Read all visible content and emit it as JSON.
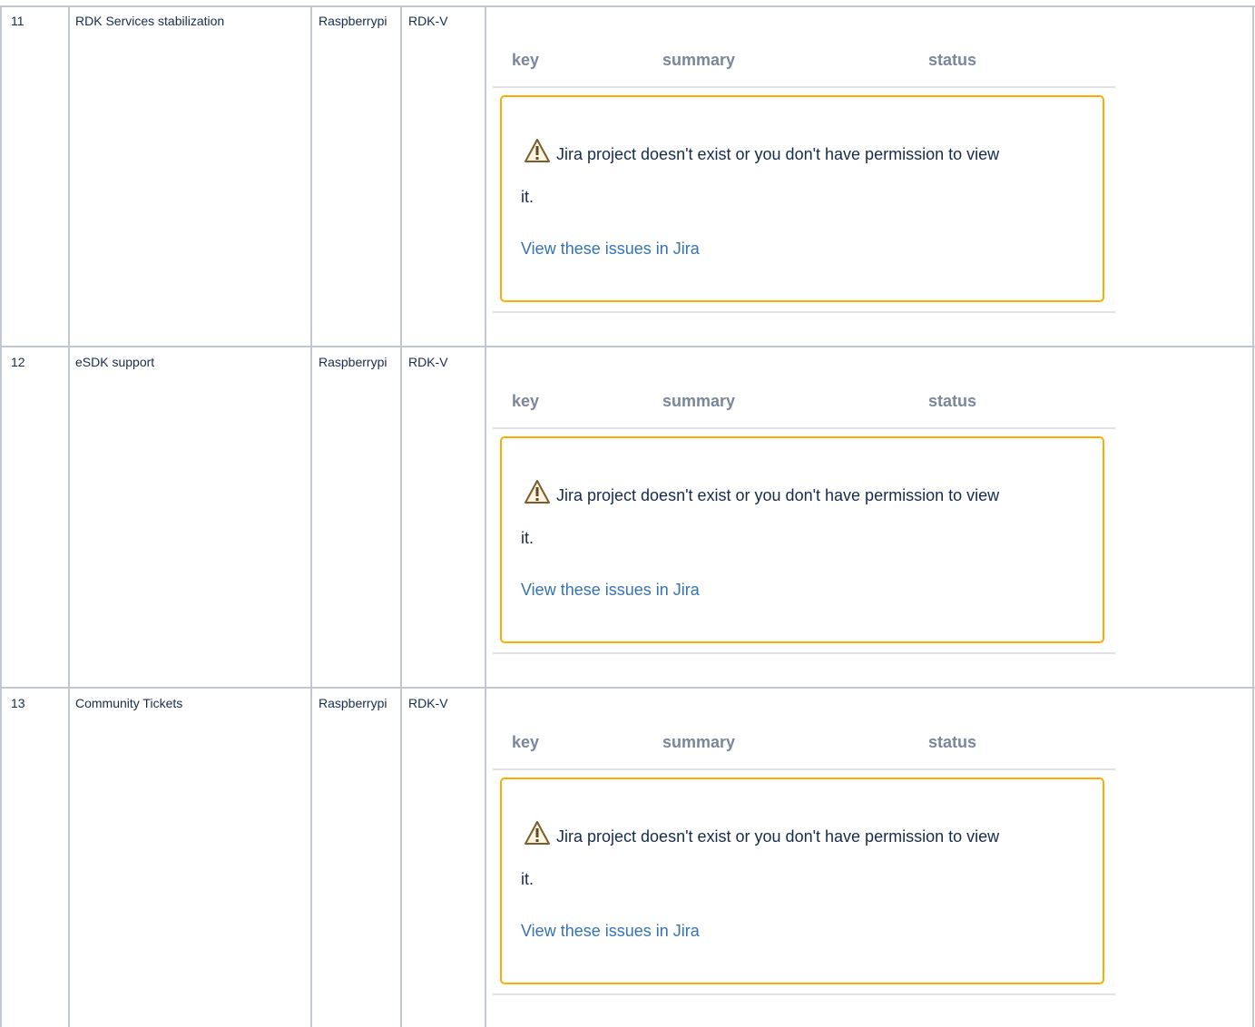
{
  "rows": [
    {
      "num": "11",
      "name": "RDK Services stabilization",
      "platform": "Raspberrypi",
      "profile": "RDK-V",
      "jira": {
        "headers": {
          "key": "key",
          "summary": "summary",
          "status": "status"
        },
        "warning_line1": "Jira project doesn't exist or you don't have permission to view",
        "warning_line2": "it.",
        "link": "View these issues in Jira"
      }
    },
    {
      "num": "12",
      "name": "eSDK support",
      "platform": "Raspberrypi",
      "profile": "RDK-V",
      "jira": {
        "headers": {
          "key": "key",
          "summary": "summary",
          "status": "status"
        },
        "warning_line1": "Jira project doesn't exist or you don't have permission to view",
        "warning_line2": "it.",
        "link": "View these issues in Jira"
      }
    },
    {
      "num": "13",
      "name": "Community Tickets",
      "platform": "Raspberrypi",
      "profile": "RDK-V",
      "jira": {
        "headers": {
          "key": "key",
          "summary": "summary",
          "status": "status"
        },
        "warning_line1": "Jira project doesn't exist or you don't have permission to view",
        "warning_line2": "it.",
        "link": "View these issues in Jira"
      }
    }
  ],
  "colors": {
    "border": "#c1c7d0",
    "warning_border": "#ffab00",
    "link": "#3572b0",
    "header_text": "#7a869a"
  },
  "icons": {
    "warning": "warning-icon"
  }
}
